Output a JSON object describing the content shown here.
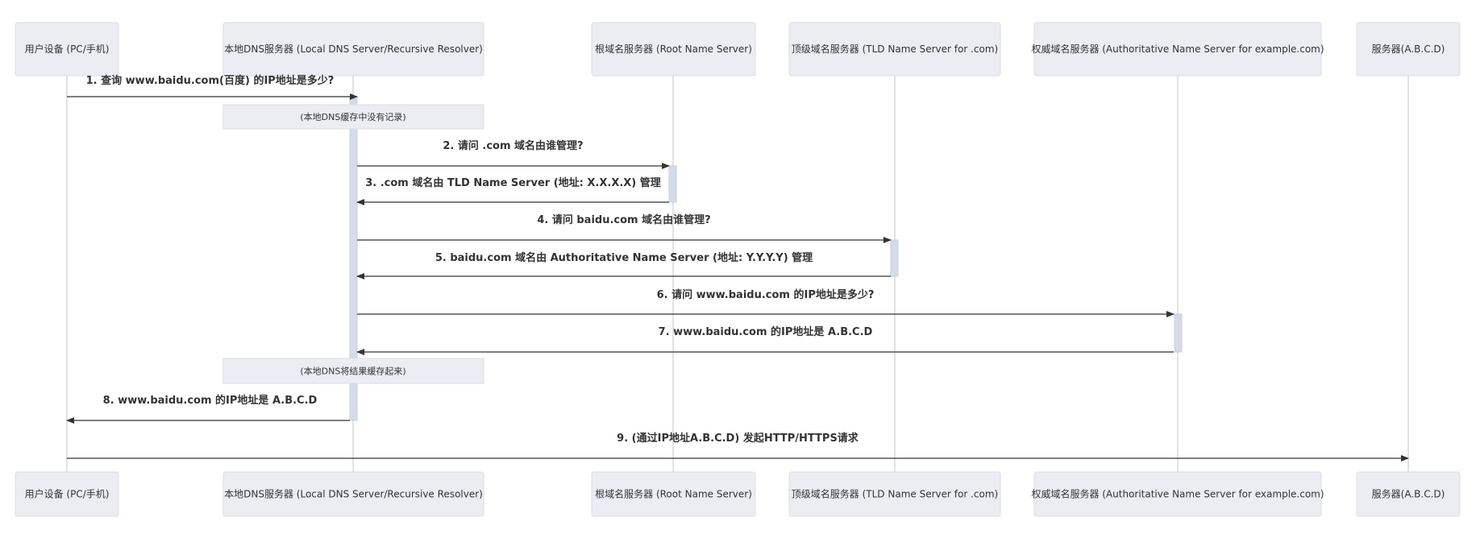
{
  "participants": [
    {
      "label": "用户设备 (PC/手机)"
    },
    {
      "label": "本地DNS服务器 (Local DNS Server/Recursive Resolver)"
    },
    {
      "label": "根域名服务器 (Root Name Server)"
    },
    {
      "label": "顶级域名服务器 (TLD Name Server for .com)"
    },
    {
      "label": "权威域名服务器 (Authoritative Name Server for example.com)"
    },
    {
      "label": "服务器(A.B.C.D)"
    }
  ],
  "messages": [
    {
      "from": 0,
      "to": 1,
      "label": "1. 查询 www.baidu.com(百度) 的IP地址是多少?"
    },
    {
      "note": "(本地DNS缓存中没有记录)",
      "over": 1
    },
    {
      "from": 1,
      "to": 2,
      "label": "2. 请问 .com 域名由谁管理?"
    },
    {
      "from": 2,
      "to": 1,
      "label": "3. .com 域名由 TLD Name Server (地址: X.X.X.X) 管理"
    },
    {
      "from": 1,
      "to": 3,
      "label": "4. 请问 baidu.com 域名由谁管理?"
    },
    {
      "from": 3,
      "to": 1,
      "label": "5. baidu.com 域名由 Authoritative Name Server (地址: Y.Y.Y.Y) 管理"
    },
    {
      "from": 1,
      "to": 4,
      "label": "6. 请问 www.baidu.com 的IP地址是多少?"
    },
    {
      "from": 4,
      "to": 1,
      "label": "7. www.baidu.com 的IP地址是 A.B.C.D"
    },
    {
      "note": "(本地DNS将结果缓存起来)",
      "over": 1
    },
    {
      "from": 1,
      "to": 0,
      "label": "8. www.baidu.com 的IP地址是 A.B.C.D"
    },
    {
      "from": 0,
      "to": 5,
      "label": "9. (通过IP地址A.B.C.D) 发起HTTP/HTTPS请求"
    }
  ]
}
